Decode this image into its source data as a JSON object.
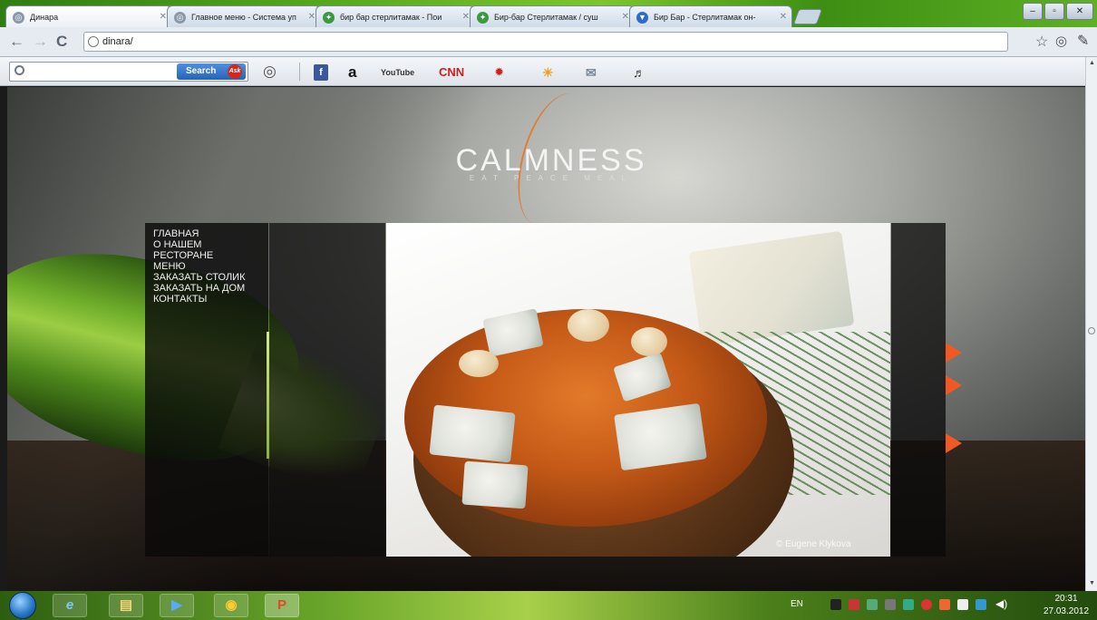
{
  "browser": {
    "tabs": [
      {
        "title": "Динара",
        "active": true
      },
      {
        "title": "Главное меню - Система уп",
        "active": false
      },
      {
        "title": "бир бар стерлитамак - Пои",
        "active": false
      },
      {
        "title": "Бир-бар Стерлитамак / суш",
        "active": false
      },
      {
        "title": "Бир Бар - Стерлитамак он-",
        "active": false
      }
    ],
    "url": "dinara/",
    "window_controls": {
      "minimize": "–",
      "maximize": "▫",
      "close": "✕"
    }
  },
  "ask_toolbar": {
    "search_placeholder": "",
    "search_button": "Search",
    "ask_badge": "Ask",
    "items": [
      {
        "name": "facebook",
        "label": "f"
      },
      {
        "name": "amazon",
        "label": "a"
      },
      {
        "name": "youtube",
        "label": "YouTube"
      },
      {
        "name": "cnn",
        "label": "CNN"
      }
    ]
  },
  "site": {
    "brand": "CALMNESS",
    "tagline": "EAT PEACE MEAL",
    "menu": [
      "ГЛАВНАЯ",
      "О НАШЕМ",
      "РЕСТОРАНЕ",
      "МЕНЮ",
      "ЗАКАЗАТЬ СТОЛИК",
      "ЗАКАЗАТЬ НА ДОМ",
      "КОНТАКТЫ"
    ],
    "photo_credit": "© Eugene Klykova"
  },
  "taskbar": {
    "language": "EN",
    "time": "20:31",
    "date": "27.03.2012"
  },
  "colors": {
    "accent_orange": "#f05a22",
    "chrome_green": "#56a81e"
  }
}
